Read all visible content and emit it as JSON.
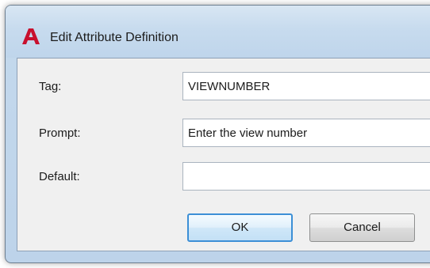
{
  "window": {
    "title": "Edit Attribute Definition",
    "icon": "autocad-logo-icon",
    "icon_color": "#c8102e"
  },
  "form": {
    "tag": {
      "label": "Tag:",
      "value": "VIEWNUMBER"
    },
    "prompt": {
      "label": "Prompt:",
      "value": "Enter the view number"
    },
    "default": {
      "label": "Default:",
      "value": ""
    }
  },
  "buttons": {
    "ok_label": "OK",
    "cancel_label": "Cancel"
  }
}
